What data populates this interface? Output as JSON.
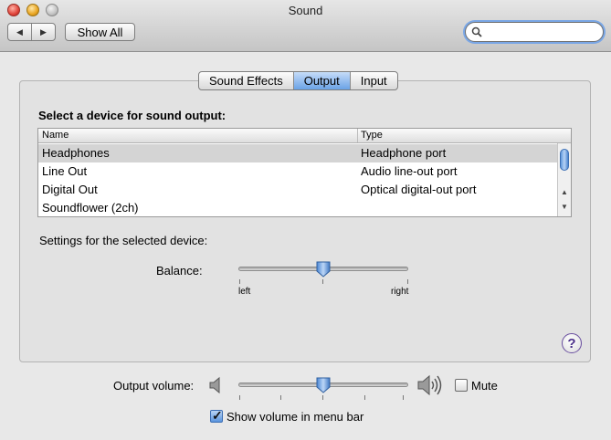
{
  "window": {
    "title": "Sound"
  },
  "toolbar": {
    "back_icon": "◀",
    "forward_icon": "▶",
    "show_all_label": "Show All",
    "search_value": "",
    "search_placeholder": ""
  },
  "tabs": [
    {
      "label": "Sound Effects",
      "active": false
    },
    {
      "label": "Output",
      "active": true
    },
    {
      "label": "Input",
      "active": false
    }
  ],
  "output": {
    "heading": "Select a device for sound output:",
    "columns": [
      "Name",
      "Type"
    ],
    "devices": [
      {
        "name": "Headphones",
        "type": "Headphone port",
        "selected": true
      },
      {
        "name": "Line Out",
        "type": "Audio line-out port",
        "selected": false
      },
      {
        "name": "Digital Out",
        "type": "Optical digital-out port",
        "selected": false
      },
      {
        "name": "Soundflower (2ch)",
        "type": "",
        "selected": false
      }
    ],
    "settings_label": "Settings for the selected device:",
    "balance_label": "Balance:",
    "balance_left": "left",
    "balance_right": "right",
    "balance_value": 0.5
  },
  "help": {
    "label": "?"
  },
  "footer": {
    "volume_label": "Output volume:",
    "volume_value": 0.5,
    "mute_label": "Mute",
    "mute_checked": false,
    "menu_bar_label": "Show volume in menu bar",
    "menu_bar_checked": true
  },
  "colors": {
    "selection": "#d4d4d4",
    "accent": "#5a95de"
  }
}
